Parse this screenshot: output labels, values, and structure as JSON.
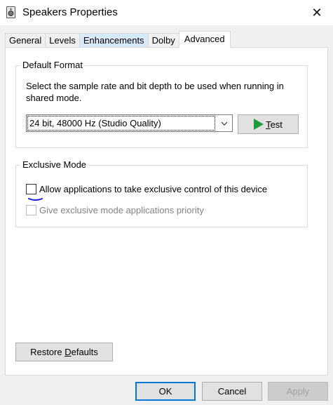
{
  "window": {
    "title": "Speakers Properties",
    "close_glyph": "✕"
  },
  "tabs": [
    {
      "label": "General",
      "state": "normal"
    },
    {
      "label": "Levels",
      "state": "normal"
    },
    {
      "label": "Enhancements",
      "state": "hover"
    },
    {
      "label": "Dolby",
      "state": "normal"
    },
    {
      "label": "Advanced",
      "state": "active"
    }
  ],
  "default_format": {
    "legend": "Default Format",
    "description": "Select the sample rate and bit depth to be used when running in shared mode.",
    "selected_format": "24 bit, 48000 Hz (Studio Quality)",
    "test_label_rest": "est",
    "test_label_mnemonic": "T"
  },
  "exclusive_mode": {
    "legend": "Exclusive Mode",
    "allow_exclusive_label": "Allow applications to take exclusive control of this device",
    "allow_exclusive_checked": false,
    "priority_label": "Give exclusive mode applications priority",
    "priority_checked": false,
    "priority_enabled": false
  },
  "buttons": {
    "restore_prefix": "Restore ",
    "restore_mnemonic": "D",
    "restore_suffix": "efaults",
    "ok": "OK",
    "cancel": "Cancel",
    "apply": "Apply"
  },
  "colors": {
    "accent": "#0078d7",
    "play": "#1f9d3c",
    "annotation": "#1a1ae6"
  }
}
